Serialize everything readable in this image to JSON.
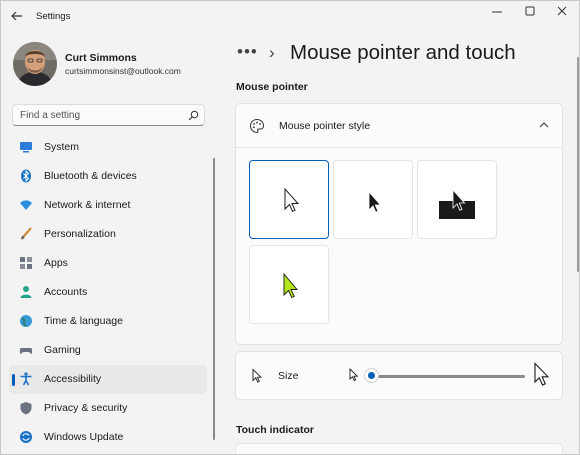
{
  "window": {
    "title": "Settings"
  },
  "profile": {
    "name": "Curt Simmons",
    "email": "curtsimmonsinst@outlook.com"
  },
  "search": {
    "placeholder": "Find a setting",
    "icon": "search-icon"
  },
  "nav": {
    "items": [
      {
        "label": "System",
        "icon": "system-icon",
        "color": "#2b7bd8",
        "active": false
      },
      {
        "label": "Bluetooth & devices",
        "icon": "bluetooth-icon",
        "color": "#1a73c9",
        "active": false
      },
      {
        "label": "Network & internet",
        "icon": "wifi-icon",
        "color": "#2b8fe0",
        "active": false
      },
      {
        "label": "Personalization",
        "icon": "brush-icon",
        "color": "#c98a3a",
        "active": false
      },
      {
        "label": "Apps",
        "icon": "apps-icon",
        "color": "#6b7280",
        "active": false
      },
      {
        "label": "Accounts",
        "icon": "accounts-icon",
        "color": "#23a48a",
        "active": false
      },
      {
        "label": "Time & language",
        "icon": "globe-icon",
        "color": "#3a9ad9",
        "active": false
      },
      {
        "label": "Gaming",
        "icon": "gaming-icon",
        "color": "#6b7280",
        "active": false
      },
      {
        "label": "Accessibility",
        "icon": "accessibility-icon",
        "color": "#1a73c9",
        "active": true
      },
      {
        "label": "Privacy & security",
        "icon": "shield-icon",
        "color": "#6b7280",
        "active": false
      },
      {
        "label": "Windows Update",
        "icon": "update-icon",
        "color": "#1a73c9",
        "active": false
      }
    ]
  },
  "header": {
    "breadcrumb_more": "•••",
    "breadcrumb_sep": "›",
    "title": "Mouse pointer and touch"
  },
  "mouse_pointer": {
    "section_title": "Mouse pointer",
    "style_label": "Mouse pointer style",
    "styles": [
      {
        "name": "white",
        "selected": true
      },
      {
        "name": "black",
        "selected": false
      },
      {
        "name": "inverted",
        "selected": false
      },
      {
        "name": "custom",
        "color": "#b5e61d",
        "selected": false
      }
    ],
    "size_label": "Size",
    "size_value": 0.0
  },
  "touch": {
    "section_title": "Touch indicator"
  },
  "colors": {
    "accent": "#005fb8"
  }
}
